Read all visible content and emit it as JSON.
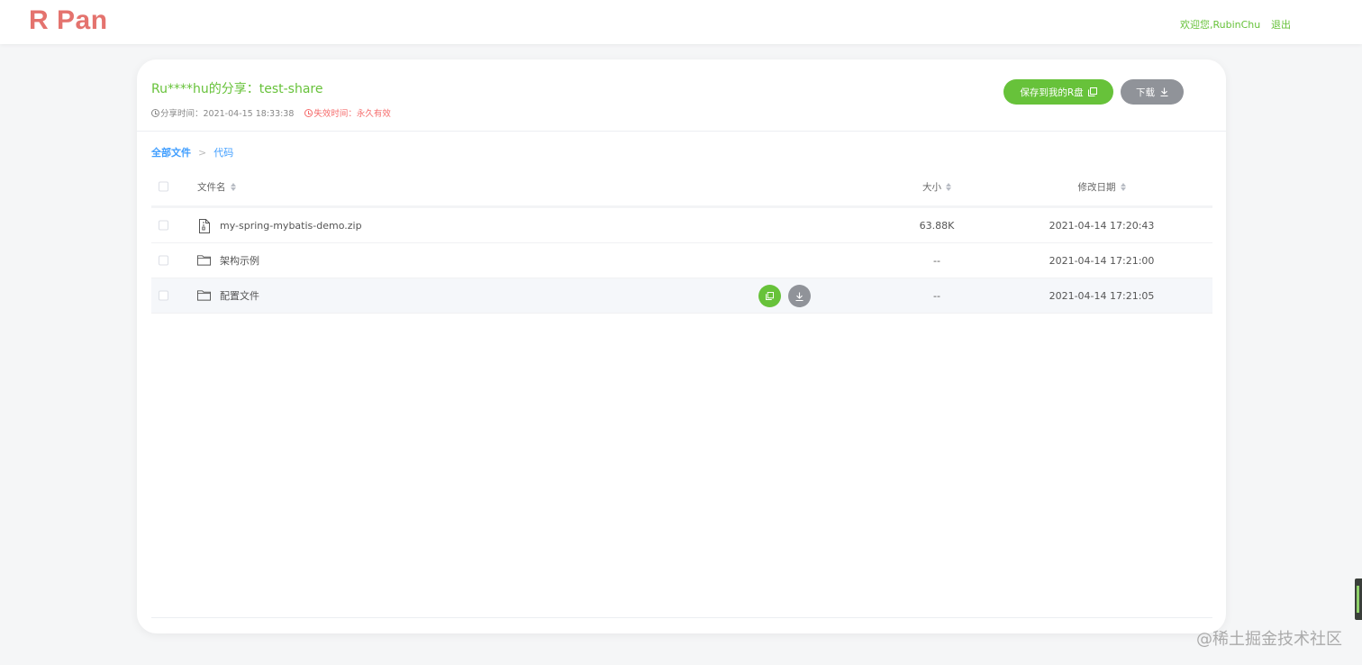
{
  "header": {
    "logo": "R Pan",
    "welcome": "欢迎您,RubinChu",
    "logout": "退出"
  },
  "share": {
    "title": "Ru****hu的分享：test-share",
    "share_time": "分享时间：2021-04-15 18:33:38",
    "expire_time": "失效时间：永久有效",
    "save_button": "保存到我的R盘",
    "download_button": "下载"
  },
  "breadcrumb": {
    "root": "全部文件",
    "separator": ">",
    "current": "代码"
  },
  "table": {
    "columns": {
      "name": "文件名",
      "size": "大小",
      "date": "修改日期"
    },
    "rows": [
      {
        "icon": "zip-file-icon",
        "name": "my-spring-mybatis-demo.zip",
        "size": "63.88K",
        "date": "2021-04-14 17:20:43"
      },
      {
        "icon": "folder-icon",
        "name": "架构示例",
        "size": "--",
        "date": "2021-04-14 17:21:00"
      },
      {
        "icon": "folder-icon",
        "name": "配置文件",
        "size": "--",
        "date": "2021-04-14 17:21:05"
      }
    ]
  },
  "watermark": "@稀土掘金技术社区",
  "colors": {
    "logo": "#e4736e",
    "primary_green": "#67c23a",
    "grey_button": "#909399",
    "link_blue": "#409eff",
    "danger": "#f56c6c",
    "row_hover": "#f5f7fa"
  }
}
